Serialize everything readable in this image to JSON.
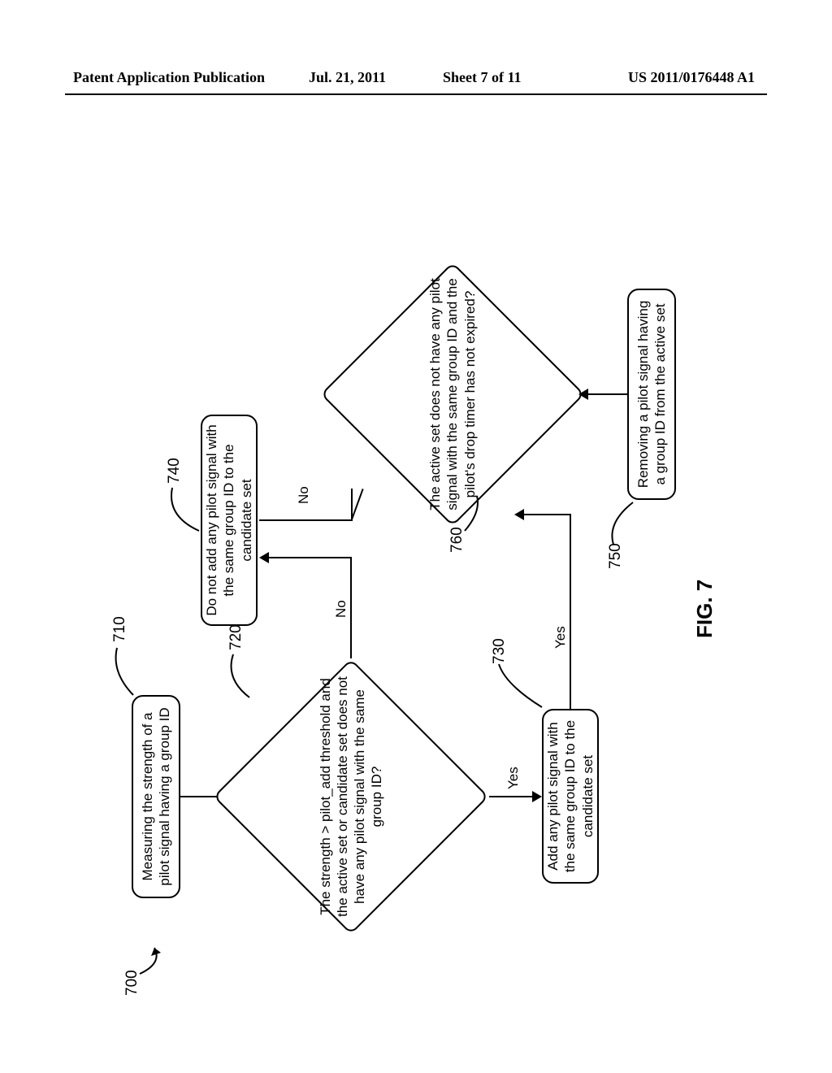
{
  "header": {
    "left": "Patent Application Publication",
    "date": "Jul. 21, 2011",
    "sheet": "Sheet 7 of 11",
    "pubno": "US 2011/0176448 A1"
  },
  "figure": {
    "caption": "FIG. 7",
    "overall_ref": "700",
    "steps": {
      "s710": {
        "ref": "710",
        "text": "Measuring the strength of a pilot signal having a group ID"
      },
      "s720": {
        "ref": "720",
        "text": "The strength > pilot_add threshold and the active set or candidate set does not have any pilot signal with the same group ID?"
      },
      "s730": {
        "ref": "730",
        "text": "Add any pilot signal with the same group ID to the candidate set"
      },
      "s740": {
        "ref": "740",
        "text": "Do not add any pilot signal with the same group ID to the candidate set"
      },
      "s750": {
        "ref": "750",
        "text": "Removing a pilot signal having a group ID from the active set"
      },
      "s760": {
        "ref": "760",
        "text": "The active set does not have any pilot signal with the same group ID and the pilot's drop timer has not expired?"
      }
    },
    "edges": {
      "yes": "Yes",
      "no": "No"
    }
  }
}
